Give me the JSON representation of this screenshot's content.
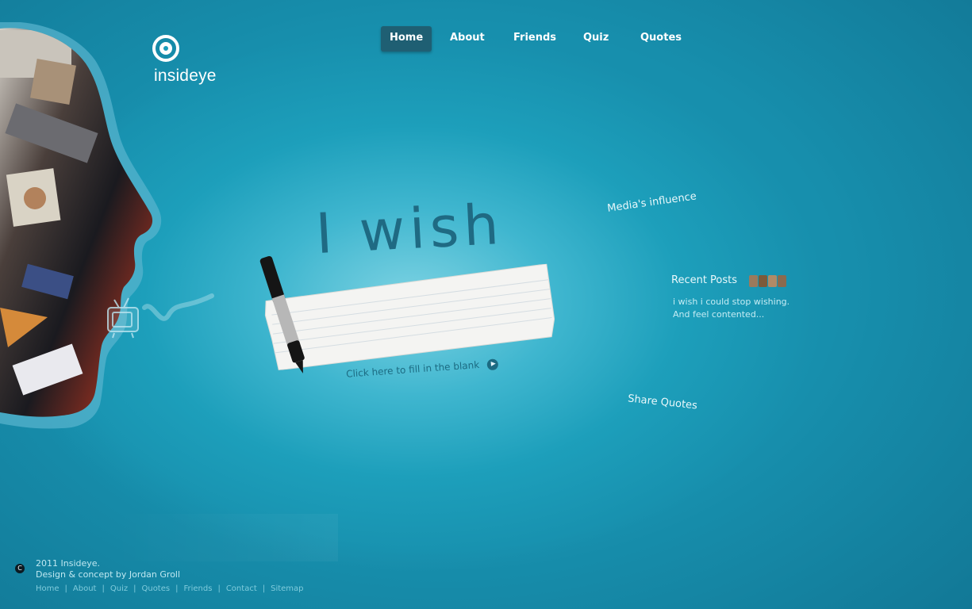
{
  "logo": {
    "text": "insideye"
  },
  "nav": {
    "items": [
      {
        "label": "Home",
        "active": true
      },
      {
        "label": "About",
        "active": false
      },
      {
        "label": "Friends",
        "active": false
      },
      {
        "label": "Quiz",
        "active": false
      },
      {
        "label": "Quotes",
        "active": false
      }
    ]
  },
  "hero": {
    "headline": "I wish",
    "fill_link": "Click here to fill in the blank"
  },
  "sidebar": {
    "media_link": "Media's influence",
    "recent_posts_title": "Recent Posts",
    "recent_post_line1": "i wish i could stop wishing.",
    "recent_post_line2": "And feel contented...",
    "share_link": "Share Quotes"
  },
  "footer": {
    "copyright_symbol": "C",
    "line1": "2011 Insideye.",
    "line2": "Design & concept by Jordan Groll",
    "links": [
      "Home",
      "About",
      "Quiz",
      "Quotes",
      "Friends",
      "Contact",
      "Sitemap"
    ]
  },
  "colors": {
    "background": "#1d9fbb",
    "nav_active": "#1f5f73",
    "headline": "#1f6a83"
  }
}
